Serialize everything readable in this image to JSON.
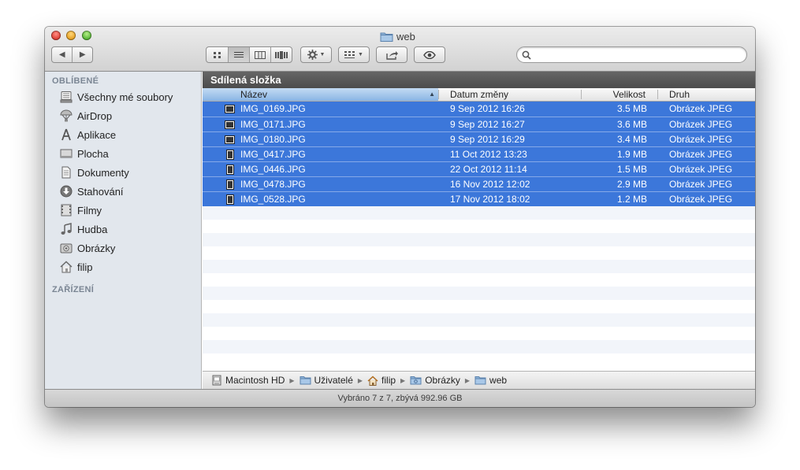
{
  "window": {
    "title": "web"
  },
  "toolbar": {
    "back_label": "◀",
    "forward_label": "▶",
    "search_placeholder": ""
  },
  "sidebar": {
    "favorites_header": "OBLÍBENÉ",
    "devices_header": "ZAŘÍZENÍ",
    "items": [
      {
        "label": "Všechny mé soubory",
        "icon": "all-files-icon"
      },
      {
        "label": "AirDrop",
        "icon": "airdrop-icon"
      },
      {
        "label": "Aplikace",
        "icon": "applications-icon"
      },
      {
        "label": "Plocha",
        "icon": "desktop-icon"
      },
      {
        "label": "Dokumenty",
        "icon": "documents-icon"
      },
      {
        "label": "Stahování",
        "icon": "downloads-icon"
      },
      {
        "label": "Filmy",
        "icon": "movies-icon"
      },
      {
        "label": "Hudba",
        "icon": "music-icon"
      },
      {
        "label": "Obrázky",
        "icon": "pictures-icon"
      },
      {
        "label": "filip",
        "icon": "home-icon"
      }
    ]
  },
  "main": {
    "shared_label": "Sdílená složka",
    "columns": {
      "name": "Název",
      "date": "Datum změny",
      "size": "Velikost",
      "kind": "Druh"
    },
    "files": [
      {
        "name": "IMG_0169.JPG",
        "date": "9 Sep 2012 16:26",
        "size": "3.5 MB",
        "kind": "Obrázek JPEG"
      },
      {
        "name": "IMG_0171.JPG",
        "date": "9 Sep 2012 16:27",
        "size": "3.6 MB",
        "kind": "Obrázek JPEG"
      },
      {
        "name": "IMG_0180.JPG",
        "date": "9 Sep 2012 16:29",
        "size": "3.4 MB",
        "kind": "Obrázek JPEG"
      },
      {
        "name": "IMG_0417.JPG",
        "date": "11 Oct 2012 13:23",
        "size": "1.9 MB",
        "kind": "Obrázek JPEG"
      },
      {
        "name": "IMG_0446.JPG",
        "date": "22 Oct 2012 11:14",
        "size": "1.5 MB",
        "kind": "Obrázek JPEG"
      },
      {
        "name": "IMG_0478.JPG",
        "date": "16 Nov 2012 12:02",
        "size": "2.9 MB",
        "kind": "Obrázek JPEG"
      },
      {
        "name": "IMG_0528.JPG",
        "date": "17 Nov 2012 18:02",
        "size": "1.2 MB",
        "kind": "Obrázek JPEG"
      }
    ]
  },
  "pathbar": [
    {
      "label": "Macintosh HD",
      "icon": "hard-drive-icon"
    },
    {
      "label": "Uživatelé",
      "icon": "folder-icon"
    },
    {
      "label": "filip",
      "icon": "home-icon"
    },
    {
      "label": "Obrázky",
      "icon": "pictures-folder-icon"
    },
    {
      "label": "web",
      "icon": "folder-icon"
    }
  ],
  "status": {
    "text": "Vybráno 7 z 7, zbývá 992.96 GB"
  },
  "colors": {
    "selection": "#3c77da",
    "sidebar": "#e2e7ed",
    "shared_bar": "#555555"
  }
}
